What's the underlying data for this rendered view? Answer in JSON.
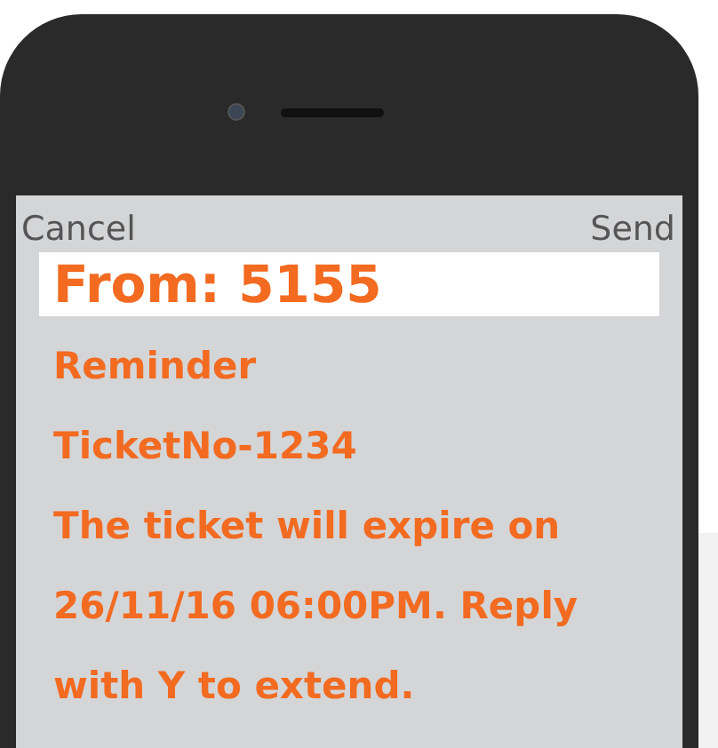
{
  "header": {
    "cancel": "Cancel",
    "send": "Send"
  },
  "from": "From: 5155",
  "message_lines": [
    "Reminder",
    "TicketNo-1234",
    "The ticket will expire on",
    "26/11/16 06:00PM. Reply",
    "with Y to extend."
  ]
}
